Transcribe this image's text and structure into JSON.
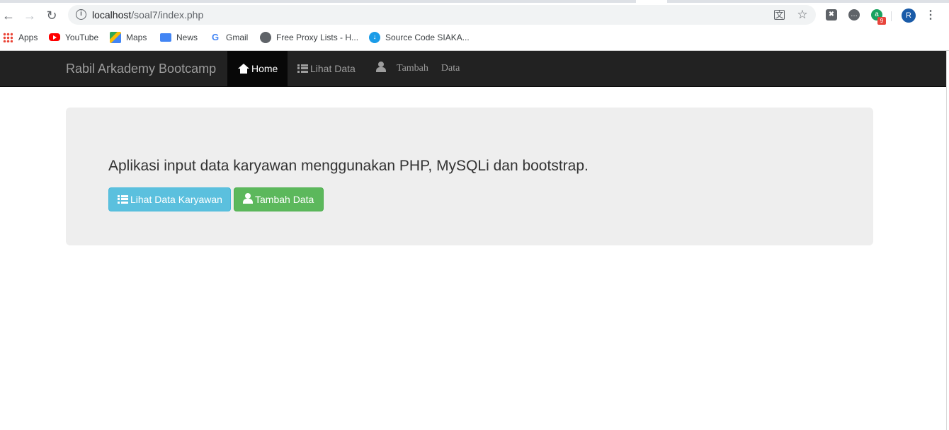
{
  "browser": {
    "url_host": "localhost",
    "url_path": "/soal7/index.php",
    "profile_initial": "R",
    "extension_badge": "9",
    "bookmarks": [
      {
        "label": "Apps",
        "icon": "apps-grid-icon"
      },
      {
        "label": "YouTube",
        "icon": "youtube-icon"
      },
      {
        "label": "Maps",
        "icon": "maps-icon"
      },
      {
        "label": "News",
        "icon": "news-icon"
      },
      {
        "label": "Gmail",
        "icon": "google-g-icon"
      },
      {
        "label": "Free Proxy Lists - H...",
        "icon": "globe-icon"
      },
      {
        "label": "Source Code SIAKA...",
        "icon": "download-icon"
      }
    ]
  },
  "navbar": {
    "brand": "Rabil Arkademy Bootcamp",
    "items": [
      {
        "label": "Home",
        "icon": "home-icon",
        "active": true
      },
      {
        "label": "Lihat Data",
        "icon": "list-icon",
        "active": false
      },
      {
        "label_word1": "Tambah",
        "label_word2": "Data",
        "icon": "user-icon",
        "active": false
      }
    ]
  },
  "jumbotron": {
    "lead": "Aplikasi input data karyawan menggunakan PHP, MySQLi dan bootstrap.",
    "buttons": [
      {
        "label": "Lihat Data Karyawan",
        "icon": "list-icon",
        "style": "info",
        "color": "#5bc0de"
      },
      {
        "label": "Tambah Data",
        "icon": "user-icon",
        "style": "success",
        "color": "#5cb85c"
      }
    ]
  },
  "colors": {
    "navbar_bg": "#222222",
    "navbar_active_bg": "#080808",
    "jumbotron_bg": "#eeeeee"
  }
}
